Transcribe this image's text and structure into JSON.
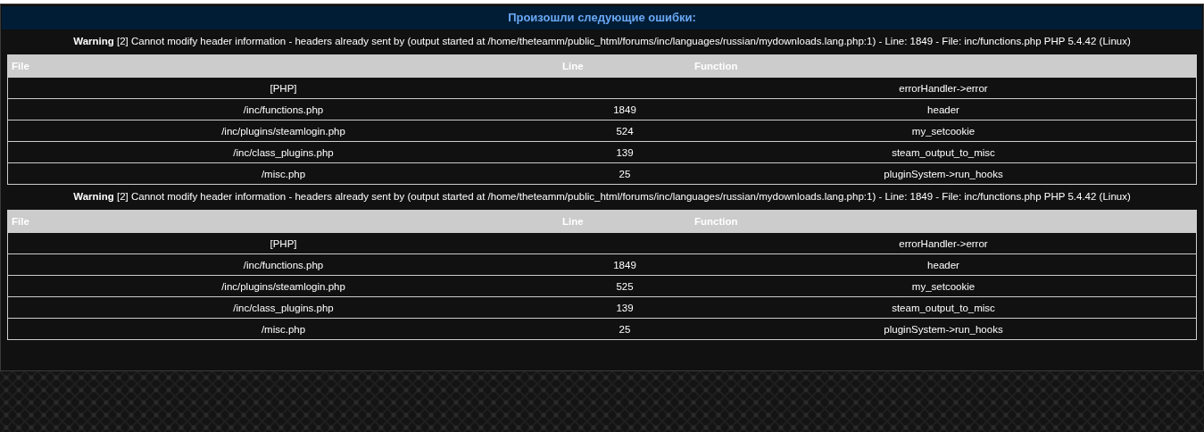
{
  "title": "Произошли следующие ошибки:",
  "errors": [
    {
      "label": "Warning",
      "message": "[2] Cannot modify header information - headers already sent by (output started at /home/theteamm/public_html/forums/inc/languages/russian/mydownloads.lang.php:1) - Line: 1849 - File: inc/functions.php PHP 5.4.42 (Linux)",
      "columns": [
        "File",
        "Line",
        "Function"
      ],
      "rows": [
        {
          "file": "[PHP]",
          "line": "",
          "function": "errorHandler->error"
        },
        {
          "file": "/inc/functions.php",
          "line": "1849",
          "function": "header"
        },
        {
          "file": "/inc/plugins/steamlogin.php",
          "line": "524",
          "function": "my_setcookie"
        },
        {
          "file": "/inc/class_plugins.php",
          "line": "139",
          "function": "steam_output_to_misc"
        },
        {
          "file": "/misc.php",
          "line": "25",
          "function": "pluginSystem->run_hooks"
        }
      ]
    },
    {
      "label": "Warning",
      "message": "[2] Cannot modify header information - headers already sent by (output started at /home/theteamm/public_html/forums/inc/languages/russian/mydownloads.lang.php:1) - Line: 1849 - File: inc/functions.php PHP 5.4.42 (Linux)",
      "columns": [
        "File",
        "Line",
        "Function"
      ],
      "rows": [
        {
          "file": "[PHP]",
          "line": "",
          "function": "errorHandler->error"
        },
        {
          "file": "/inc/functions.php",
          "line": "1849",
          "function": "header"
        },
        {
          "file": "/inc/plugins/steamlogin.php",
          "line": "525",
          "function": "my_setcookie"
        },
        {
          "file": "/inc/class_plugins.php",
          "line": "139",
          "function": "steam_output_to_misc"
        },
        {
          "file": "/misc.php",
          "line": "25",
          "function": "pluginSystem->run_hooks"
        }
      ]
    }
  ]
}
